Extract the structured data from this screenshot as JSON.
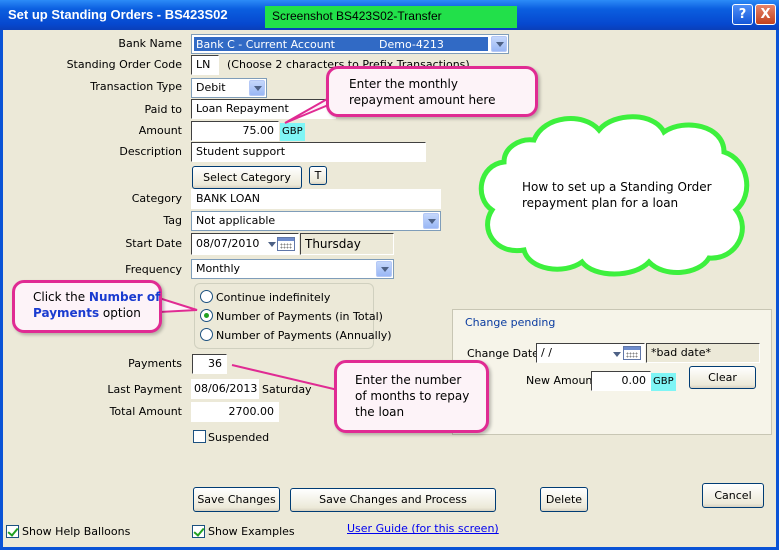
{
  "titlebar": {
    "title": "Set up Standing Orders - BS423S02",
    "screenshot_label": "Screenshot BS423S02-Transfer",
    "help_label": "?",
    "close_label": "X"
  },
  "form": {
    "bank_name_label": "Bank Name",
    "bank_name_value": "Bank C - Current Account",
    "bank_name_code": "Demo-4213",
    "so_code_label": "Standing Order Code",
    "so_code_value": "LN",
    "so_code_hint": "(Choose 2 characters to Prefix Transactions)",
    "transaction_type_label": "Transaction Type",
    "transaction_type_value": "Debit",
    "paid_to_label": "Paid to",
    "paid_to_value": "Loan Repayment",
    "amount_label": "Amount",
    "amount_value": "75.00",
    "amount_currency": "GBP",
    "description_label": "Description",
    "description_value": "Student support",
    "select_category_label": "Select Category",
    "t_button_label": "T",
    "category_label": "Category",
    "category_value": "BANK LOAN",
    "tag_label": "Tag",
    "tag_value": "Not applicable",
    "start_date_label": "Start Date",
    "start_date_value": "08/07/2010",
    "start_day": "Thursday",
    "frequency_label": "Frequency",
    "frequency_value": "Monthly",
    "radio_continue": "Continue indefinitely",
    "radio_total": "Number of Payments (in Total)",
    "radio_annually": "Number of Payments (Annually)",
    "payments_label": "Payments",
    "payments_value": "36",
    "last_payment_label": "Last Payment",
    "last_payment_value": "08/06/2013",
    "last_payment_day": "Saturday",
    "total_amount_label": "Total Amount",
    "total_amount_value": "2700.00",
    "suspended_label": "Suspended"
  },
  "pending": {
    "title": "Change pending",
    "change_date_label": "Change Date",
    "change_date_value": " / /",
    "bad_date": "*bad date*",
    "new_amount_label": "New Amount",
    "new_amount_value": "0.00",
    "new_amount_currency": "GBP",
    "clear_label": "Clear"
  },
  "buttons": {
    "save_changes": "Save Changes",
    "save_and_process": "Save Changes and Process",
    "delete": "Delete",
    "cancel": "Cancel"
  },
  "footer": {
    "show_help_balloons": "Show Help Balloons",
    "show_examples": "Show Examples",
    "user_guide": "User Guide (for this screen)"
  },
  "balloons": {
    "amount_hint_line1": "Enter the monthly",
    "amount_hint_line2": "repayment amount here",
    "number_payments_prefix": "Click the ",
    "number_payments_bold1": "Number of",
    "number_payments_bold2": "Payments",
    "number_payments_suffix": " option",
    "months_line1": "Enter the number",
    "months_line2": "of months to repay",
    "months_line3": "the loan",
    "cloud_line1": "How to set up a Standing Order",
    "cloud_line2": "repayment plan for a loan"
  },
  "colors": {
    "titlebar_blue": "#0b5fe0",
    "screenshot_label_bg": "#22e04a",
    "balloon_border": "#e02b93",
    "cloud_border": "#3df03d",
    "currency_bg": "#7ff5f5"
  }
}
